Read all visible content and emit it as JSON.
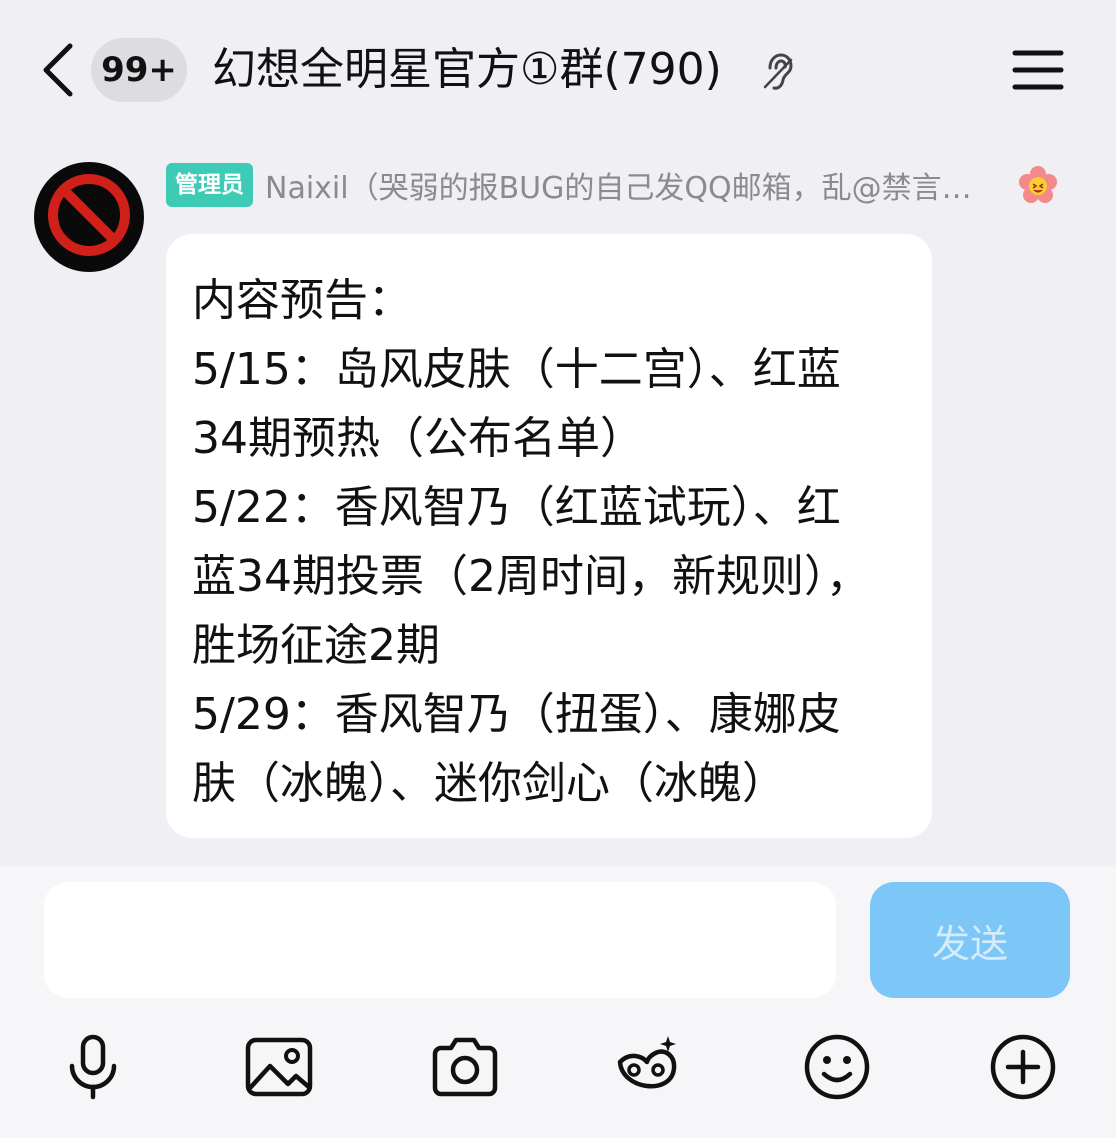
{
  "header": {
    "back_icon": "chevron-left-icon",
    "unread_badge": "99+",
    "group_title": "幻想全明星官方①群(790)",
    "ear_icon": "ear-icon",
    "menu_icon": "hamburger-menu-icon"
  },
  "message": {
    "avatar_icon": "prohibited-sign-avatar",
    "role_tag": "管理员",
    "sender_name": "Naixil（哭弱的报BUG的自己发QQ邮箱，乱@禁言…",
    "level_icon": "flower-emoji-icon",
    "lines": [
      "内容预告：",
      "5/15：岛风皮肤（十二宫）、红蓝",
      "34期预热（公布名单）",
      "5/22：香风智乃（红蓝试玩）、红",
      "蓝34期投票（2周时间，新规则），",
      "胜场征途2期",
      "5/29：香风智乃（扭蛋）、康娜皮",
      "肤（冰魄）、迷你剑心（冰魄）"
    ]
  },
  "composer": {
    "input_value": "",
    "send_label": "发送",
    "accent_color": "#7cc6f8",
    "tools": [
      "microphone-icon",
      "image-icon",
      "camera-icon",
      "sticker-face-icon",
      "emoji-icon",
      "plus-icon"
    ]
  }
}
